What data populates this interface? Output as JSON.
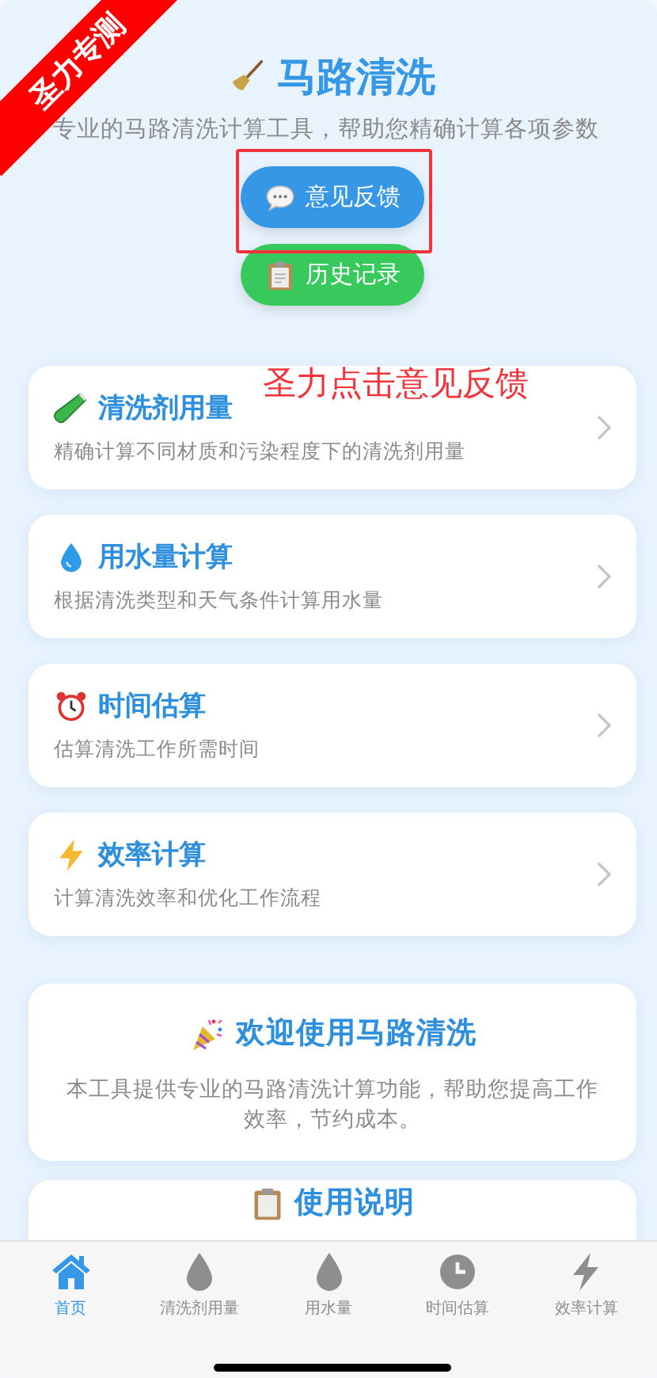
{
  "header": {
    "title": "马路清洗",
    "subtitle": "专业的马路清洗计算工具，帮助您精确计算各项参数"
  },
  "actions": [
    {
      "kind": "feedback",
      "label": "意见反馈"
    },
    {
      "kind": "history",
      "label": "历史记录"
    }
  ],
  "tools": [
    {
      "kind": "tube",
      "title": "清洗剂用量",
      "description": "精确计算不同材质和污染程度下的清洗剂用量"
    },
    {
      "kind": "drop",
      "title": "用水量计算",
      "description": "根据清洗类型和天气条件计算用水量"
    },
    {
      "kind": "clock",
      "title": "时间估算",
      "description": "估算清洗工作所需时间"
    },
    {
      "kind": "bolt",
      "title": "效率计算",
      "description": "计算清洗效率和优化工作流程"
    }
  ],
  "welcome": {
    "title": "欢迎使用马路清洗",
    "text": "本工具提供专业的马路清洗计算功能，帮助您提高工作效率，节约成本。"
  },
  "guide": {
    "title": "使用说明"
  },
  "tab_bar": [
    {
      "kind": "home",
      "label": "首页",
      "selected": true
    },
    {
      "kind": "drop",
      "label": "清洗剂用量",
      "selected": false
    },
    {
      "kind": "drop",
      "label": "用水量",
      "selected": false
    },
    {
      "kind": "clock",
      "label": "时间估算",
      "selected": false
    },
    {
      "kind": "bolt",
      "label": "效率计算",
      "selected": false
    }
  ],
  "annotations": {
    "ribbon": "圣力专测",
    "note": "圣力点击意见反馈"
  }
}
